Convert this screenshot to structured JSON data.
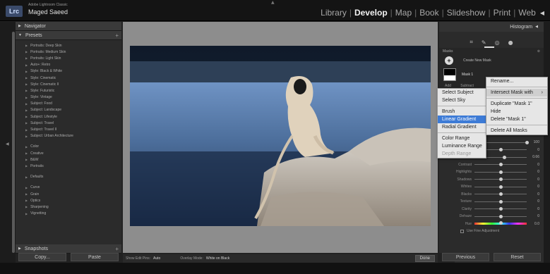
{
  "app": {
    "logo": "Lrc",
    "app_name": "Adobe Lightroom Classic",
    "user": "Maged Saeed"
  },
  "modules": [
    {
      "label": "Library",
      "active": false
    },
    {
      "label": "Develop",
      "active": true
    },
    {
      "label": "Map",
      "active": false
    },
    {
      "label": "Book",
      "active": false
    },
    {
      "label": "Slideshow",
      "active": false
    },
    {
      "label": "Print",
      "active": false
    },
    {
      "label": "Web",
      "active": false
    }
  ],
  "navigator": {
    "label": "Navigator",
    "zoom_options": "FIT  100%  66.7%"
  },
  "presets": {
    "label": "Presets",
    "items": [
      "Portraits: Deep Skin",
      "Portraits: Medium Skin",
      "Portraits: Light Skin",
      "Auto+: Retro",
      "Style: Black & White",
      "Style: Cinematic",
      "Style: Cinematic II",
      "Style: Futuristic",
      "Style: Vintage",
      "Subject: Food",
      "Subject: Landscape",
      "Subject: Lifestyle",
      "Subject: Travel",
      "Subject: Travel II",
      "Subject: Urban Architecture"
    ],
    "groups": [
      "Color",
      "Creative",
      "B&W",
      "Portraits"
    ],
    "defaults": "Defaults",
    "groups2": [
      "Curve",
      "Grain",
      "Optics",
      "Sharpening",
      "Vignetting"
    ]
  },
  "snapshots": {
    "label": "Snapshots"
  },
  "left_buttons": {
    "copy": "Copy...",
    "paste": "Paste"
  },
  "toolbar": {
    "show_edit_pins_label": "Show Edit Pins:",
    "show_edit_pins_value": "Auto",
    "overlay_mode_label": "Overlay Mode:",
    "overlay_mode_value": "White on Black",
    "done": "Done"
  },
  "histogram": {
    "label": "Histogram"
  },
  "masks": {
    "label": "Masks",
    "create_new": "Create New Mask",
    "mask1": "Mask 1",
    "add": "Add",
    "subtract": "Subtract"
  },
  "add_menu": {
    "items": [
      "Select Subject",
      "Select Sky"
    ],
    "items2": [
      "Brush",
      "Linear Gradient",
      "Radial Gradient"
    ],
    "selected": "Linear Gradient",
    "items3": [
      "Color Range",
      "Luminance Range",
      "Depth Range"
    ],
    "disabled": "Depth Range"
  },
  "mask_menu": {
    "items": [
      "Rename..."
    ],
    "submenu": "Intersect Mask with",
    "items2": [
      "Duplicate \"Mask 1\"",
      "Hide",
      "Delete \"Mask 1\""
    ],
    "items3": [
      "Delete All Masks"
    ]
  },
  "adjustments": [
    {
      "label": "Amount",
      "value": "100",
      "pos": 1.0
    },
    {
      "label": "Temp",
      "value": "0",
      "pos": 0.5
    },
    {
      "label": "Exposure",
      "value": "0.66",
      "pos": 0.58
    },
    {
      "label": "Contrast",
      "value": "0",
      "pos": 0.5
    },
    {
      "label": "Highlights",
      "value": "0",
      "pos": 0.5
    },
    {
      "label": "Shadows",
      "value": "0",
      "pos": 0.5
    },
    {
      "label": "Whites",
      "value": "0",
      "pos": 0.5
    },
    {
      "label": "Blacks",
      "value": "0",
      "pos": 0.5
    },
    {
      "label": "Texture",
      "value": "0",
      "pos": 0.5
    },
    {
      "label": "Clarity",
      "value": "0",
      "pos": 0.5
    },
    {
      "label": "Dehaze",
      "value": "0",
      "pos": 0.5
    },
    {
      "label": "Hue",
      "value": "0.0",
      "pos": 0.5
    }
  ],
  "fine_adjust": "Use Fine Adjustment",
  "right_buttons": {
    "previous": "Previous",
    "reset": "Reset"
  }
}
